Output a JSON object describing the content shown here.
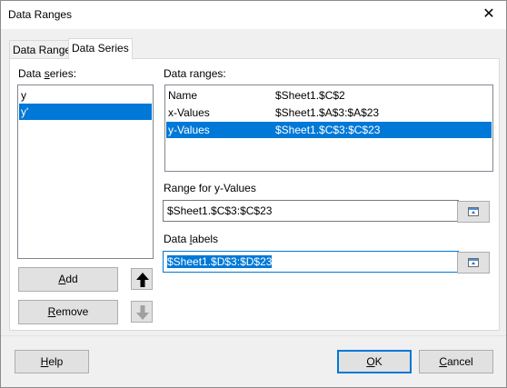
{
  "window": {
    "title": "Data Ranges"
  },
  "tabs": [
    {
      "label": "Data Range",
      "active": false
    },
    {
      "label": "Data Series",
      "active": true
    }
  ],
  "series": {
    "label_prefix": "Data ",
    "label_access": "s",
    "label_suffix": "eries:",
    "items": [
      "y",
      "y'"
    ],
    "selected_index": 1
  },
  "ranges": {
    "label": "Data ranges:",
    "rows": [
      {
        "name": "Name",
        "value": "$Sheet1.$C$2"
      },
      {
        "name": "x-Values",
        "value": "$Sheet1.$A$3:$A$23"
      },
      {
        "name": "y-Values",
        "value": "$Sheet1.$C$3:$C$23"
      }
    ],
    "selected_index": 2
  },
  "range_for": {
    "label": "Range for y-Values",
    "value": "$Sheet1.$C$3:$C$23"
  },
  "data_labels": {
    "label_prefix": "Data ",
    "label_access": "l",
    "label_suffix": "abels",
    "value": "$Sheet1.$D$3:$D$23"
  },
  "buttons": {
    "add": {
      "access": "A",
      "rest": "dd"
    },
    "remove": {
      "access": "R",
      "rest": "emove"
    },
    "help": {
      "access": "H",
      "rest": "elp"
    },
    "ok": {
      "access": "O",
      "rest": "K"
    },
    "cancel": {
      "access": "C",
      "rest": "ancel"
    }
  },
  "icons": {
    "close": "close-icon",
    "move_up": "arrow-up-icon",
    "move_down": "arrow-down-icon",
    "shrink": "shrink-dialog-icon"
  },
  "colors": {
    "selection": "#0078d7",
    "dialog_bg": "#f0f0f0"
  }
}
